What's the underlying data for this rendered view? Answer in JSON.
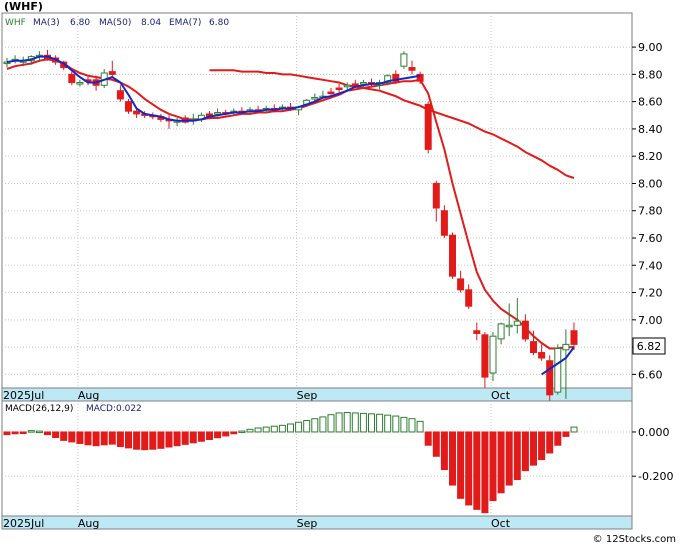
{
  "chart_data": [
    {
      "type": "candlestick",
      "title": "(WHF)",
      "legend": [
        {
          "label": "WHF",
          "color": "#2e7d32"
        },
        {
          "label": "MA(3)",
          "value": "6.80",
          "color": "#1a237e"
        },
        {
          "label": "MA(50)",
          "value": "8.04",
          "color": "#1a237e"
        },
        {
          "label": "EMA(7)",
          "value": "6.80",
          "color": "#1a237e"
        }
      ],
      "y_range": [
        6.5,
        9.25
      ],
      "y_ticks": [
        "9.00",
        "8.80",
        "8.60",
        "8.40",
        "8.20",
        "8.00",
        "7.80",
        "7.60",
        "7.40",
        "7.20",
        "7.00",
        "6.80",
        "6.60"
      ],
      "last_price_label": "6.82",
      "x_labels": [
        {
          "label": "2025Jul",
          "index": 0
        },
        {
          "label": "Aug",
          "index": 9
        },
        {
          "label": "Sep",
          "index": 36
        },
        {
          "label": "Oct",
          "index": 60
        }
      ],
      "up_color": "#2e7d32",
      "down_color": "#e31a1a",
      "ohlc": [
        [
          8.88,
          8.92,
          8.85,
          8.89
        ],
        [
          8.9,
          8.94,
          8.88,
          8.91
        ],
        [
          8.89,
          8.93,
          8.86,
          8.9
        ],
        [
          8.9,
          8.94,
          8.87,
          8.93
        ],
        [
          8.93,
          8.97,
          8.89,
          8.94
        ],
        [
          8.94,
          8.98,
          8.9,
          8.91
        ],
        [
          8.92,
          8.94,
          8.87,
          8.89
        ],
        [
          8.89,
          8.9,
          8.83,
          8.85
        ],
        [
          8.8,
          8.82,
          8.72,
          8.74
        ],
        [
          8.74,
          8.76,
          8.71,
          8.74
        ],
        [
          8.76,
          8.79,
          8.72,
          8.75
        ],
        [
          8.76,
          8.79,
          8.68,
          8.72
        ],
        [
          8.72,
          8.84,
          8.7,
          8.81
        ],
        [
          8.82,
          8.9,
          8.78,
          8.8
        ],
        [
          8.68,
          8.72,
          8.6,
          8.62
        ],
        [
          8.6,
          8.62,
          8.51,
          8.53
        ],
        [
          8.53,
          8.55,
          8.48,
          8.51
        ],
        [
          8.51,
          8.53,
          8.48,
          8.5
        ],
        [
          8.5,
          8.52,
          8.47,
          8.49
        ],
        [
          8.49,
          8.51,
          8.45,
          8.47
        ],
        [
          8.47,
          8.5,
          8.4,
          8.46
        ],
        [
          8.46,
          8.48,
          8.42,
          8.46
        ],
        [
          8.48,
          8.5,
          8.44,
          8.45
        ],
        [
          8.46,
          8.51,
          8.43,
          8.47
        ],
        [
          8.47,
          8.52,
          8.45,
          8.5
        ],
        [
          8.51,
          8.53,
          8.47,
          8.49
        ],
        [
          8.51,
          8.55,
          8.49,
          8.52
        ],
        [
          8.52,
          8.54,
          8.5,
          8.51
        ],
        [
          8.52,
          8.55,
          8.5,
          8.53
        ],
        [
          8.53,
          8.56,
          8.51,
          8.52
        ],
        [
          8.53,
          8.56,
          8.51,
          8.54
        ],
        [
          8.54,
          8.57,
          8.52,
          8.53
        ],
        [
          8.54,
          8.57,
          8.52,
          8.55
        ],
        [
          8.55,
          8.58,
          8.52,
          8.54
        ],
        [
          8.55,
          8.58,
          8.53,
          8.56
        ],
        [
          8.56,
          8.59,
          8.53,
          8.55
        ],
        [
          8.54,
          8.57,
          8.5,
          8.56
        ],
        [
          8.58,
          8.62,
          8.56,
          8.61
        ],
        [
          8.62,
          8.66,
          8.6,
          8.63
        ],
        [
          8.64,
          8.68,
          8.62,
          8.64
        ],
        [
          8.67,
          8.7,
          8.64,
          8.66
        ],
        [
          8.7,
          8.73,
          8.67,
          8.69
        ],
        [
          8.71,
          8.74,
          8.68,
          8.72
        ],
        [
          8.73,
          8.76,
          8.7,
          8.72
        ],
        [
          8.73,
          8.76,
          8.7,
          8.74
        ],
        [
          8.74,
          8.77,
          8.71,
          8.73
        ],
        [
          8.72,
          8.76,
          8.69,
          8.74
        ],
        [
          8.74,
          8.8,
          8.72,
          8.79
        ],
        [
          8.8,
          8.83,
          8.73,
          8.75
        ],
        [
          8.86,
          8.97,
          8.84,
          8.95
        ],
        [
          8.85,
          8.9,
          8.8,
          8.83
        ],
        [
          8.8,
          8.82,
          8.73,
          8.75
        ],
        [
          8.58,
          8.6,
          8.22,
          8.25
        ],
        [
          8.0,
          8.02,
          7.72,
          7.82
        ],
        [
          7.8,
          7.84,
          7.6,
          7.62
        ],
        [
          7.62,
          7.64,
          7.3,
          7.32
        ],
        [
          7.3,
          7.36,
          7.2,
          7.22
        ],
        [
          7.22,
          7.26,
          7.08,
          7.1
        ],
        [
          6.92,
          6.98,
          6.85,
          6.9
        ],
        [
          6.89,
          6.91,
          6.5,
          6.58
        ],
        [
          6.61,
          6.91,
          6.55,
          6.88
        ],
        [
          6.86,
          6.98,
          6.82,
          6.97
        ],
        [
          6.96,
          7.12,
          6.88,
          6.96
        ],
        [
          6.96,
          7.16,
          6.9,
          6.99
        ],
        [
          6.99,
          7.04,
          6.84,
          6.86
        ],
        [
          6.84,
          6.92,
          6.74,
          6.76
        ],
        [
          6.76,
          6.82,
          6.7,
          6.72
        ],
        [
          6.7,
          6.74,
          6.4,
          6.45
        ],
        [
          6.47,
          6.82,
          6.45,
          6.79
        ],
        [
          6.78,
          6.93,
          6.42,
          6.82
        ],
        [
          6.92,
          6.98,
          6.78,
          6.82
        ]
      ],
      "series": [
        {
          "name": "EMA(7)",
          "color": "#e31a1a",
          "values": [
            8.84,
            8.86,
            8.87,
            8.88,
            8.9,
            8.91,
            8.9,
            8.88,
            8.84,
            8.81,
            8.79,
            8.78,
            8.77,
            8.76,
            8.74,
            8.71,
            8.67,
            8.62,
            8.58,
            8.54,
            8.51,
            8.49,
            8.47,
            8.47,
            8.47,
            8.48,
            8.48,
            8.49,
            8.5,
            8.51,
            8.51,
            8.52,
            8.52,
            8.53,
            8.53,
            8.54,
            8.55,
            8.57,
            8.59,
            8.61,
            8.63,
            8.65,
            8.68,
            8.69,
            8.7,
            8.71,
            8.72,
            8.73,
            8.74,
            8.75,
            8.75,
            8.76,
            8.66,
            8.45,
            8.25,
            8.0,
            7.78,
            7.56,
            7.35,
            7.22,
            7.14,
            7.08,
            7.04,
            7.0,
            6.94,
            6.88,
            6.83,
            6.79,
            6.79,
            6.8,
            6.8
          ]
        },
        {
          "name": "MA(3)",
          "color": "#1428c8",
          "values": [
            8.89,
            8.9,
            8.9,
            8.91,
            8.93,
            8.93,
            8.91,
            8.88,
            8.83,
            8.78,
            8.74,
            8.74,
            8.76,
            8.78,
            8.74,
            8.65,
            8.55,
            8.51,
            8.5,
            8.49,
            8.47,
            8.46,
            8.46,
            8.46,
            8.47,
            8.49,
            8.5,
            8.51,
            8.52,
            8.52,
            8.53,
            8.53,
            8.54,
            8.54,
            8.55,
            8.55,
            8.56,
            8.58,
            8.6,
            8.63,
            8.64,
            8.66,
            8.68,
            8.71,
            8.72,
            8.73,
            8.73,
            8.75,
            8.76,
            8.77,
            8.78,
            8.79
          ]
        },
        {
          "name": "MA(50)",
          "color": "#e31a1a",
          "values": [
            8.83,
            8.83,
            8.83,
            8.83,
            8.82,
            8.82,
            8.82,
            8.81,
            8.81,
            8.8,
            8.8,
            8.79,
            8.78,
            8.77,
            8.76,
            8.75,
            8.74,
            8.72,
            8.71,
            8.7,
            8.69,
            8.68,
            8.66,
            8.64,
            8.61,
            8.59,
            8.57,
            8.54,
            8.52,
            8.5,
            8.48,
            8.46,
            8.44,
            8.41,
            8.38,
            8.36,
            8.33,
            8.3,
            8.27,
            8.23,
            8.2,
            8.17,
            8.13,
            8.1,
            8.06,
            8.04
          ]
        }
      ]
    },
    {
      "type": "bar",
      "title": "MACD(26,12,9)",
      "value_label": "MACD:0.022",
      "y_range": [
        -0.38,
        0.14
      ],
      "y_ticks": [
        "0.000",
        "-0.200"
      ],
      "x_labels": [
        {
          "label": "2025Jul",
          "index": 0
        },
        {
          "label": "Aug",
          "index": 9
        },
        {
          "label": "Sep",
          "index": 36
        },
        {
          "label": "Oct",
          "index": 60
        }
      ],
      "values": [
        -0.012,
        -0.008,
        -0.005,
        0.006,
        0.004,
        -0.012,
        -0.025,
        -0.038,
        -0.045,
        -0.052,
        -0.058,
        -0.062,
        -0.058,
        -0.055,
        -0.066,
        -0.072,
        -0.078,
        -0.08,
        -0.078,
        -0.074,
        -0.068,
        -0.062,
        -0.056,
        -0.049,
        -0.042,
        -0.034,
        -0.026,
        -0.018,
        -0.008,
        0.004,
        0.012,
        0.018,
        0.022,
        0.026,
        0.03,
        0.036,
        0.044,
        0.052,
        0.06,
        0.068,
        0.078,
        0.086,
        0.088,
        0.086,
        0.084,
        0.082,
        0.08,
        0.076,
        0.072,
        0.066,
        0.06,
        0.048,
        -0.06,
        -0.11,
        -0.17,
        -0.24,
        -0.3,
        -0.33,
        -0.35,
        -0.365,
        -0.31,
        -0.275,
        -0.24,
        -0.215,
        -0.175,
        -0.15,
        -0.125,
        -0.095,
        -0.06,
        -0.02,
        0.022
      ]
    }
  ],
  "watermark": "© 12Stocks.com"
}
